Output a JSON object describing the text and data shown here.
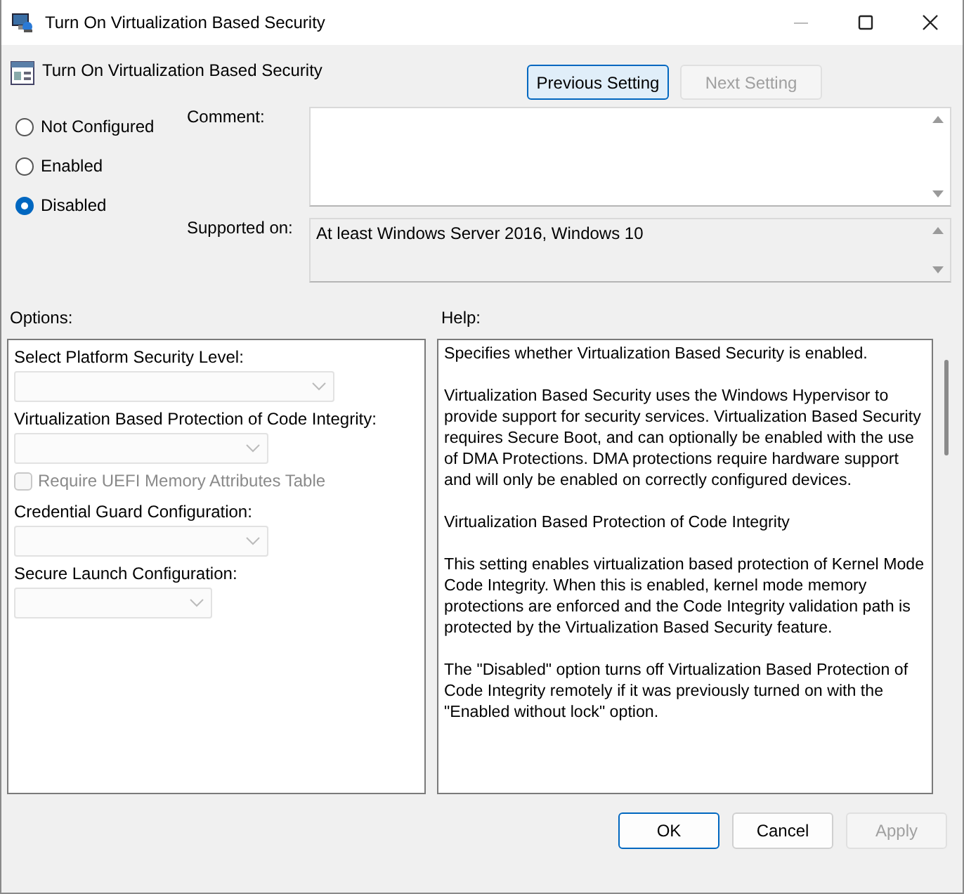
{
  "window": {
    "title": "Turn On Virtualization Based Security"
  },
  "header": {
    "title": "Turn On Virtualization Based Security"
  },
  "nav_buttons": [
    {
      "label": "Previous Setting",
      "disabled": false
    },
    {
      "label": "Next Setting",
      "disabled": true
    }
  ],
  "state_options": [
    {
      "label": "Not Configured",
      "selected": false
    },
    {
      "label": "Enabled",
      "selected": false
    },
    {
      "label": "Disabled",
      "selected": true
    }
  ],
  "comment": {
    "label": "Comment:"
  },
  "supported_on": {
    "label": "Supported on:",
    "value": "At least Windows Server 2016, Windows 10"
  },
  "options": {
    "label": "Options:",
    "items": [
      {
        "kind": "label",
        "text": "Select Platform Security Level:"
      },
      {
        "kind": "dropdown",
        "disabled": true
      },
      {
        "kind": "label",
        "text": "Virtualization Based Protection of Code Integrity:"
      },
      {
        "kind": "dropdown",
        "disabled": true
      },
      {
        "kind": "checkbox",
        "text": "Require UEFI Memory Attributes Table",
        "checked": false,
        "disabled": true
      },
      {
        "kind": "label",
        "text": "Credential Guard Configuration:"
      },
      {
        "kind": "dropdown",
        "disabled": true
      },
      {
        "kind": "label",
        "text": "Secure Launch Configuration:"
      },
      {
        "kind": "dropdown",
        "disabled": true
      }
    ]
  },
  "help": {
    "label": "Help:",
    "paragraphs": [
      "Specifies whether Virtualization Based Security is enabled.",
      "Virtualization Based Security uses the Windows Hypervisor to provide support for security services. Virtualization Based Security requires Secure Boot, and can optionally be enabled with the use of DMA Protections. DMA protections require hardware support and will only be enabled on correctly configured devices.",
      "Virtualization Based Protection of Code Integrity",
      "This setting enables virtualization based protection of Kernel Mode Code Integrity. When this is enabled, kernel mode memory protections are enforced and the Code Integrity validation path is protected by the Virtualization Based Security feature.",
      "The \"Disabled\" option turns off Virtualization Based Protection of Code Integrity remotely if it was previously turned on with the \"Enabled without lock\" option."
    ]
  },
  "footer_buttons": [
    {
      "label": "OK",
      "disabled": false,
      "default": true
    },
    {
      "label": "Cancel",
      "disabled": false,
      "default": false
    },
    {
      "label": "Apply",
      "disabled": true,
      "default": false
    }
  ]
}
